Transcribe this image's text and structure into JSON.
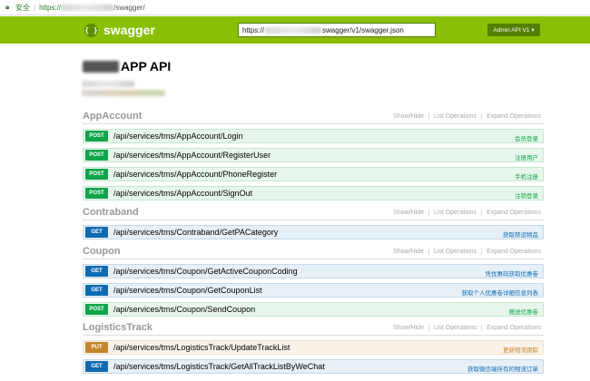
{
  "browser": {
    "security_label": "安全",
    "url_scheme": "https://",
    "url_rest": "/swagger/"
  },
  "header": {
    "logo_icon": "{ }",
    "logo_text": "swagger",
    "url_prefix": "https://",
    "url_suffix": "swagger/v1/swagger.json",
    "api_selector": "Admin API V1 ▾"
  },
  "info": {
    "title": "APP API"
  },
  "resources": [
    {
      "name": "AppAccount",
      "show_hide": "Show/Hide",
      "list_ops": "List Operations",
      "expand_ops": "Expand Operations",
      "operations": [
        {
          "method": "POST",
          "path": "/api/services/tms/AppAccount/Login",
          "summary": "会员登录"
        },
        {
          "method": "POST",
          "path": "/api/services/tms/AppAccount/RegisterUser",
          "summary": "注册用户"
        },
        {
          "method": "POST",
          "path": "/api/services/tms/AppAccount/PhoneRegister",
          "summary": "手机注册"
        },
        {
          "method": "POST",
          "path": "/api/services/tms/AppAccount/SignOut",
          "summary": "注销登录"
        }
      ]
    },
    {
      "name": "Contraband",
      "show_hide": "Show/Hide",
      "list_ops": "List Operations",
      "expand_ops": "Expand Operations",
      "operations": [
        {
          "method": "GET",
          "path": "/api/services/tms/Contraband/GetPACategory",
          "summary": "获取禁运物品"
        }
      ]
    },
    {
      "name": "Coupon",
      "show_hide": "Show/Hide",
      "list_ops": "List Operations",
      "expand_ops": "Expand Operations",
      "operations": [
        {
          "method": "GET",
          "path": "/api/services/tms/Coupon/GetActiveCouponCoding",
          "summary": "凭优惠码获取优惠卷"
        },
        {
          "method": "GET",
          "path": "/api/services/tms/Coupon/GetCouponList",
          "summary": "获取个人优惠卷详细信息列表"
        },
        {
          "method": "POST",
          "path": "/api/services/tms/Coupon/SendCoupon",
          "summary": "赠送优惠卷"
        }
      ]
    },
    {
      "name": "LogisticsTrack",
      "show_hide": "Show/Hide",
      "list_ops": "List Operations",
      "expand_ops": "Expand Operations",
      "operations": [
        {
          "method": "PUT",
          "path": "/api/services/tms/LogisticsTrack/UpdateTrackList",
          "summary": "更新物流跟踪"
        },
        {
          "method": "GET",
          "path": "/api/services/tms/LogisticsTrack/GetAllTrackListByWeChat",
          "summary": "获取微信端所有的物流订单"
        }
      ]
    }
  ],
  "colors": {
    "header_green": "#89bf04",
    "post": "#10a54a",
    "get": "#0f6ab4",
    "put": "#c5862b"
  }
}
